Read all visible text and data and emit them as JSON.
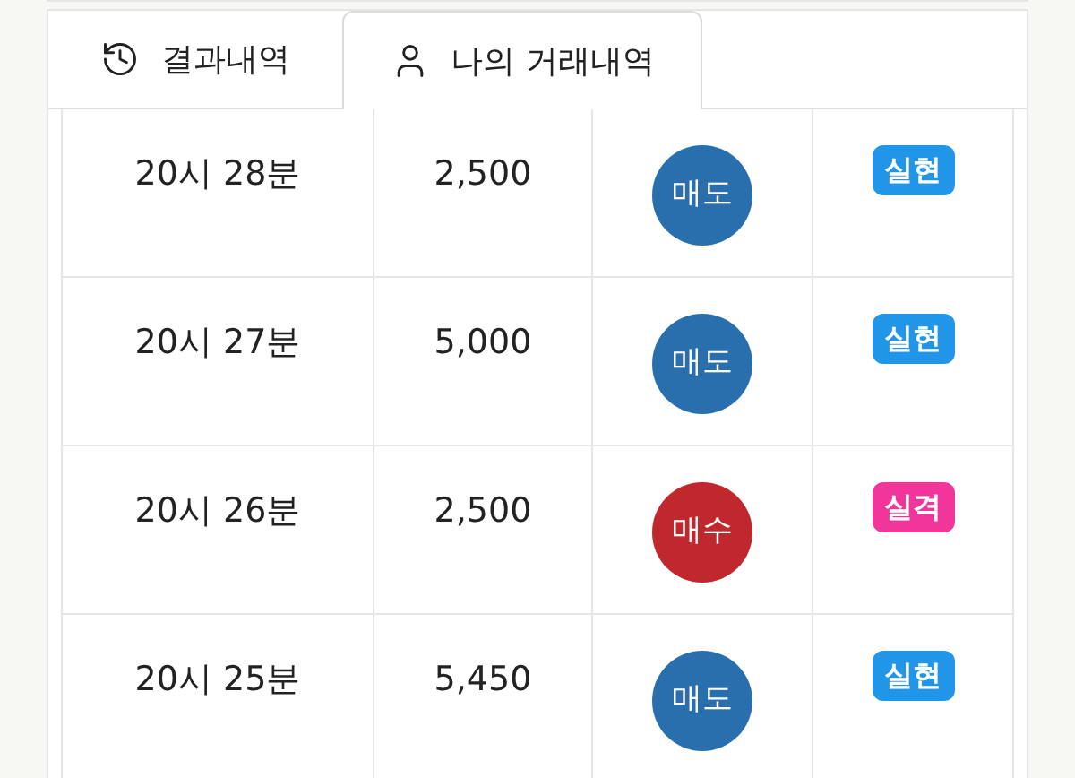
{
  "tabs": [
    {
      "label": "결과내역",
      "kind": "history",
      "selected": false
    },
    {
      "label": "나의 거래내역",
      "kind": "user",
      "selected": true
    }
  ],
  "rows": [
    {
      "time": "20시 28분",
      "amount": "2,500",
      "side": {
        "label": "매도",
        "kind": "sell"
      },
      "result": {
        "label": "실현",
        "kind": "hit"
      }
    },
    {
      "time": "20시 27분",
      "amount": "5,000",
      "side": {
        "label": "매도",
        "kind": "sell"
      },
      "result": {
        "label": "실현",
        "kind": "hit"
      }
    },
    {
      "time": "20시 26분",
      "amount": "2,500",
      "side": {
        "label": "매수",
        "kind": "buy"
      },
      "result": {
        "label": "실격",
        "kind": "miss"
      }
    },
    {
      "time": "20시 25분",
      "amount": "5,450",
      "side": {
        "label": "매도",
        "kind": "sell"
      },
      "result": {
        "label": "실현",
        "kind": "hit"
      }
    }
  ]
}
